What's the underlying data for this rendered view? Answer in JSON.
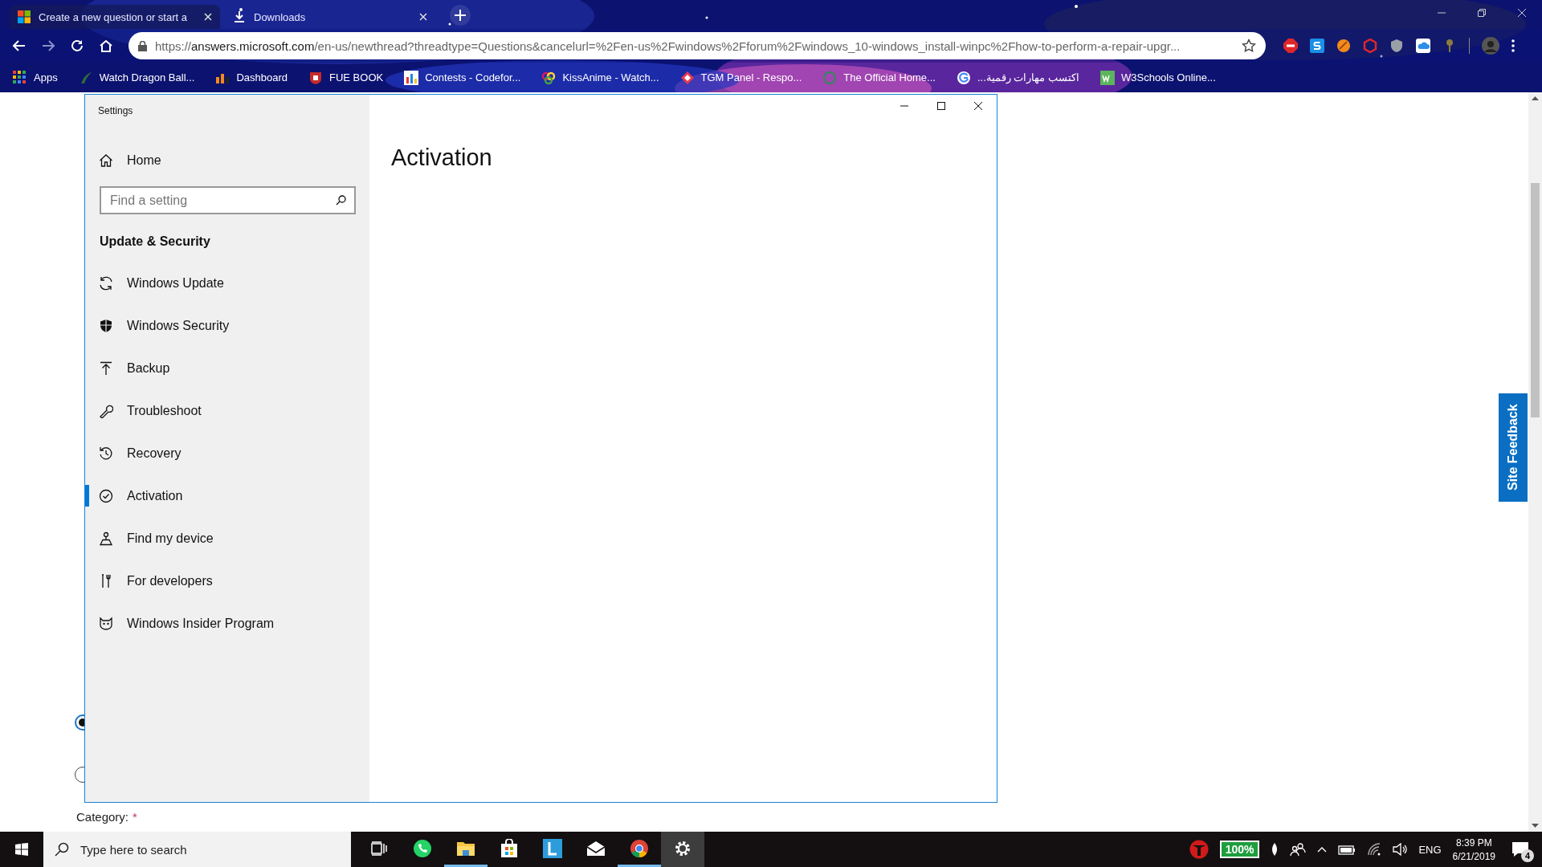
{
  "browser": {
    "tabs": [
      {
        "title": "Create a new question or start a",
        "selected": true
      },
      {
        "title": "Downloads",
        "selected": false
      }
    ],
    "url": {
      "scheme": "https://",
      "host": "answers.microsoft.com",
      "rest": "/en-us/newthread?threadtype=Questions&cancelurl=%2Fen-us%2Fwindows%2Fforum%2Fwindows_10-windows_install-winpc%2Fhow-to-perform-a-repair-upgr..."
    },
    "bookmarks": [
      {
        "label": "Apps"
      },
      {
        "label": "Watch Dragon Ball..."
      },
      {
        "label": "Dashboard"
      },
      {
        "label": "FUE BOOK"
      },
      {
        "label": "Contests - Codefor..."
      },
      {
        "label": "KissAnime - Watch..."
      },
      {
        "label": "TGM Panel - Respo..."
      },
      {
        "label": "The Official Home..."
      },
      {
        "label": "اكتسب مهارات رقمية..."
      },
      {
        "label": "W3Schools Online..."
      }
    ]
  },
  "page": {
    "radios": [
      {
        "selected": true
      },
      {
        "selected": false
      }
    ],
    "category_label": "Category:",
    "required_mark": "*",
    "feedback_tab": "Site Feedback"
  },
  "settings": {
    "title": "Settings",
    "home": "Home",
    "search": {
      "placeholder": "Find a setting"
    },
    "section": "Update & Security",
    "items": [
      {
        "label": "Windows Update",
        "selected": false
      },
      {
        "label": "Windows Security",
        "selected": false
      },
      {
        "label": "Backup",
        "selected": false
      },
      {
        "label": "Troubleshoot",
        "selected": false
      },
      {
        "label": "Recovery",
        "selected": false
      },
      {
        "label": "Activation",
        "selected": true
      },
      {
        "label": "Find my device",
        "selected": false
      },
      {
        "label": "For developers",
        "selected": false
      },
      {
        "label": "Windows Insider Program",
        "selected": false
      }
    ],
    "heading": "Activation"
  },
  "taskbar": {
    "search": {
      "placeholder": "Type here to search"
    },
    "apps": [
      {
        "running": false,
        "active": false
      },
      {
        "running": true,
        "active": false
      },
      {
        "running": false,
        "active": false
      },
      {
        "running": false,
        "active": false
      },
      {
        "running": false,
        "active": false
      },
      {
        "running": true,
        "active": false
      },
      {
        "running": false,
        "active": true
      }
    ],
    "battery_percent": "100%",
    "language": "ENG",
    "time": "8:39 PM",
    "date": "6/21/2019",
    "notification_count": "4"
  }
}
